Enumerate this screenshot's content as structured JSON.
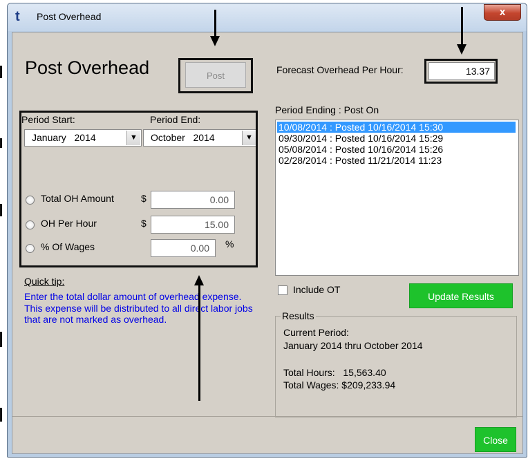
{
  "window": {
    "title": "Post Overhead",
    "app_icon": "t",
    "close_glyph": "x"
  },
  "main": {
    "heading": "Post Overhead",
    "post_label": "Post",
    "forecast_label": "Forecast Overhead Per Hour:",
    "forecast_value": "13.37"
  },
  "period": {
    "start_label": "Period Start:",
    "end_label": "Period End:",
    "start_value": "January   2014",
    "end_value": "October   2014"
  },
  "options": {
    "total_oh_label": "Total OH Amount",
    "total_oh_value": "0.00",
    "oh_per_hour_label": "OH Per Hour",
    "oh_per_hour_value": "15.00",
    "pct_wages_label": "% Of Wages",
    "pct_wages_value": "0.00",
    "dollar": "$",
    "percent": "%"
  },
  "tip": {
    "title": "Quick tip:",
    "text": "Enter the total dollar amount of overhead expense.  This expense will be distributed to all direct labor jobs that are not marked as overhead."
  },
  "list": {
    "label": "Period Ending : Post On",
    "rows": [
      "10/08/2014 : Posted 10/16/2014 15:30",
      "09/30/2014 : Posted 10/16/2014 15:29",
      "05/08/2014 : Posted 10/16/2014 15:26",
      "02/28/2014 : Posted 11/21/2014 11:23"
    ]
  },
  "controls": {
    "include_ot_label": "Include OT",
    "update_label": "Update Results",
    "close_label": "Close"
  },
  "results": {
    "legend": "Results",
    "current_period_label": "Current Period:",
    "current_period_value": "January 2014 thru October 2014",
    "total_hours_line": "Total Hours:   15,563.40",
    "total_wages_line": "Total Wages: $209,233.94"
  },
  "colors": {
    "accent_green": "#1ec22c",
    "selection_blue": "#3399ff",
    "tip_blue": "#0000e6"
  }
}
